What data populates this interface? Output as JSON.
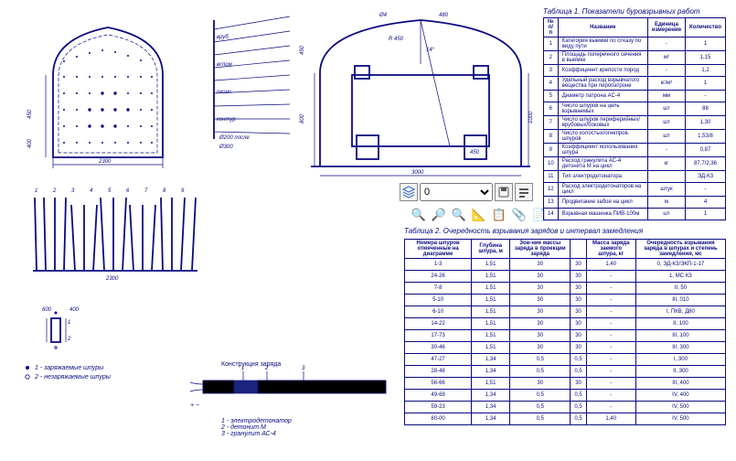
{
  "table1": {
    "title": "Таблица 1. Показатели буровзрывных работ",
    "headers": [
      "№ п/п",
      "Название",
      "Единица измерения",
      "Количество"
    ],
    "rows": [
      [
        "1",
        "Категория выемки по отказу по виду пути",
        "-",
        "1"
      ],
      [
        "2",
        "Площадь поперечного сечения в выемке",
        "м²",
        "1,15"
      ],
      [
        "3",
        "Коэффициент крепости пород",
        "-",
        "1,2"
      ],
      [
        "4",
        "Удельный расход взрывчатого вещества при пиропатроне",
        "кг/м³",
        "1"
      ],
      [
        "5",
        "Диаметр патрона АС-4",
        "мм",
        "-"
      ],
      [
        "6",
        "Число шпуров на цель взрываемых",
        "шт",
        "88"
      ],
      [
        "7",
        "Число шпуров периферийных/врубовых/боковых",
        "шт",
        "1,30"
      ],
      [
        "8",
        "Число холостых/огнепров. шпуров",
        "шт",
        "1,53/8"
      ],
      [
        "9",
        "Коэффициент использования шпура",
        "-",
        "0,87"
      ],
      [
        "10",
        "Расход гранулита АС-4 детонита М на цикл",
        "кг",
        "87,7/2,36"
      ],
      [
        "11",
        "Тип электродетонатора",
        "",
        "ЭД-КЗ"
      ],
      [
        "12",
        "Расход электродетонаторов на цикл",
        "штук",
        "-"
      ],
      [
        "13",
        "Продвигание забоя на цикл",
        "м",
        "4"
      ],
      [
        "14",
        "Взрывная машинка ПИВ-100м",
        "шт",
        "1"
      ]
    ]
  },
  "table2": {
    "title": "Таблица 2. Очередность взрывания зарядов и интервал замедления",
    "headers": [
      "Номера шпуров отмеченные на диаграмме",
      "Глубина шпура, м",
      "Зов-ние массы заряда в проекции заряда",
      "",
      "Масса заряда заемого шпура, кг",
      "Очередность взрывания заряда в шпурах и степень замедления, мс"
    ],
    "rows": [
      [
        "1-3",
        "1,51",
        "30",
        "30",
        "1,40",
        "0, ЭД-КЗ/ЭКП-1-17"
      ],
      [
        "24-26",
        "1,51",
        "30",
        "30",
        "-",
        "1, МС КЗ"
      ],
      [
        "7-8",
        "1,51",
        "30",
        "30",
        "-",
        "II, 50"
      ],
      [
        "5-10",
        "1,51",
        "30",
        "30",
        "-",
        "III, 010"
      ],
      [
        "6-10",
        "1,51",
        "30",
        "30",
        "-",
        "I, ПКВ, Д80"
      ],
      [
        "14-22",
        "1,51",
        "30",
        "30",
        "-",
        "II, 100"
      ],
      [
        "17-73",
        "1,51",
        "30",
        "30",
        "-",
        "III, 100"
      ],
      [
        "30-46",
        "1,51",
        "30",
        "30",
        "-",
        "III, 300"
      ],
      [
        "47-27",
        "1,34",
        "0,5",
        "0,5",
        "-",
        "I, 300"
      ],
      [
        "28-48",
        "1,34",
        "0,5",
        "0,5",
        "-",
        "II, 300"
      ],
      [
        "56-66",
        "1,51",
        "30",
        "30",
        "-",
        "III, 400"
      ],
      [
        "49-69",
        "1,34",
        "0,5",
        "0,5",
        "-",
        "IV, 400"
      ],
      [
        "59-23",
        "1,34",
        "0,5",
        "0,5",
        "-",
        "IV, 500"
      ],
      [
        "80-00",
        "1,34",
        "0,5",
        "0,5",
        "1,40",
        "IV, 500"
      ]
    ]
  },
  "charge": {
    "title": "Конструкция заряда",
    "legend": [
      "1 - электродетонатор",
      "2 - детонит М",
      "3 - гранулит АС-4"
    ]
  },
  "cutlegend": {
    "a": "1 - заряжаемые шпуры",
    "b": "2 - незаряжаемые шпуры"
  },
  "dims": {
    "w2300_a": "2300",
    "w2300_b": "2300",
    "w3000": "3000",
    "h800": "800",
    "h450": "450",
    "h400": "400",
    "h1000": "1000",
    "r450": "R 450",
    "ang14": "14°",
    "v450a": "450",
    "v450b": "450",
    "s_vrub": "вруб",
    "s_vspom": "вспом",
    "s_okonch": "оконч",
    "s_kontur": "контур",
    "dser": "Ø200 после",
    "d300": "Ø300",
    "d4": "Ø4",
    "d480": "480",
    "plusminus": "+ −"
  },
  "toolbar": {
    "layer_value": "0"
  }
}
